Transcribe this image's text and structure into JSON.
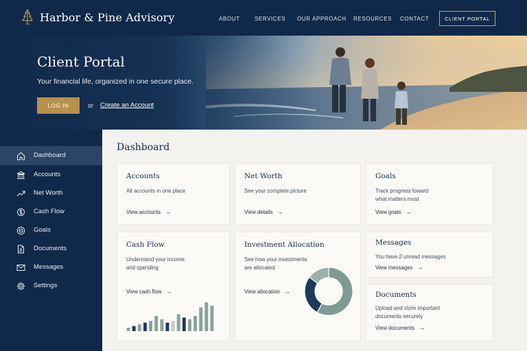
{
  "brand": {
    "name": "Harbor & Pine Advisory",
    "logo_icon": "pine-tree-icon"
  },
  "nav": {
    "items": [
      "ABOUT",
      "SERVICES",
      "OUR APPROACH",
      "RESOURCES",
      "CONTACT"
    ],
    "portal_button": "CLIENT PORTAL"
  },
  "hero": {
    "title": "Client Portal",
    "subtitle": "Your financial life, organized in one secure place.",
    "login_button": "LOG IN",
    "or_text": "or",
    "create_link": "Create an Account"
  },
  "sidebar": {
    "items": [
      {
        "label": "Dashboard",
        "icon": "home-icon",
        "active": true
      },
      {
        "label": "Accounts",
        "icon": "bank-icon"
      },
      {
        "label": "Net Worth",
        "icon": "trending-up-icon"
      },
      {
        "label": "Cash Flow",
        "icon": "cash-flow-icon"
      },
      {
        "label": "Goals",
        "icon": "target-icon"
      },
      {
        "label": "Documents",
        "icon": "document-icon"
      },
      {
        "label": "Messages",
        "icon": "envelope-icon"
      },
      {
        "label": "Settings",
        "icon": "gear-icon"
      }
    ]
  },
  "main": {
    "title": "Dashboard",
    "cards": {
      "accounts": {
        "title": "Accounts",
        "desc": "All accounts in one place",
        "link": "View accounts"
      },
      "net_worth": {
        "title": "Net Worth",
        "desc": "See your complete picture",
        "link": "View details"
      },
      "goals": {
        "title": "Goals",
        "desc_lines": [
          "Track progress toward",
          "what matters most"
        ],
        "link": "View goals"
      },
      "cash_flow": {
        "title": "Cash Flow",
        "desc_lines": [
          "Understand your income",
          "and spending"
        ],
        "link": "View cash flow"
      },
      "allocation": {
        "title": "Investment Allocation",
        "desc_lines": [
          "See how your investments",
          "are allocated"
        ],
        "link": "View allocation"
      },
      "messages": {
        "title": "Messages",
        "desc": "You have 2 unread messages",
        "link": "View messages"
      },
      "documents": {
        "title": "Documents",
        "desc_lines": [
          "Upload and store important",
          "documents securely"
        ],
        "link": "View documents"
      }
    },
    "arrow": "→"
  },
  "colors": {
    "navy": "#10294a",
    "gold": "#b8914a",
    "sage": "#7f9a94",
    "slate": "#1e3a5c"
  },
  "chart_data": [
    {
      "type": "bar",
      "name": "",
      "values": [
        2,
        3,
        4,
        5,
        6,
        9,
        7,
        5,
        6,
        10,
        8,
        7,
        9,
        14,
        17,
        15
      ],
      "colors": [
        "#8aa29c",
        "#1e3a5c",
        "#8aa29c",
        "#1e3a5c",
        "#8aa29c",
        "#8aa29c",
        "#8aa29c",
        "#1e3a5c",
        "#c9c9c4",
        "#8aa29c",
        "#1e3a5c",
        "#8aa29c",
        "#8aa29c",
        "#8aa29c",
        "#8aa29c",
        "#8aa29c"
      ]
    },
    {
      "type": "pie",
      "donut": true,
      "values": [
        58,
        27,
        15
      ],
      "colors": [
        "#7f9a94",
        "#1e3a5c",
        "#9db0ab"
      ]
    }
  ]
}
